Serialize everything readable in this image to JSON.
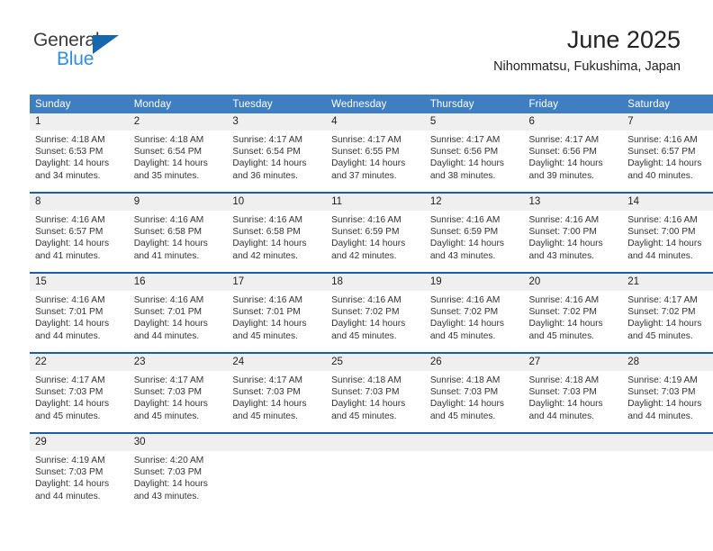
{
  "logo": {
    "word_top": "General",
    "word_bottom": "Blue",
    "triangle_color": "#1666b0",
    "top_color": "#3c3c3c",
    "bottom_color": "#2e8fe0"
  },
  "header": {
    "title": "June 2025",
    "subtitle": "Nihommatsu, Fukushima, Japan"
  },
  "theme": {
    "header_bg": "#3f7fc1",
    "header_text": "#ffffff",
    "daynum_bg": "#efefef",
    "rule_color": "#1a5fa4",
    "body_text": "#333333"
  },
  "weekdays": [
    "Sunday",
    "Monday",
    "Tuesday",
    "Wednesday",
    "Thursday",
    "Friday",
    "Saturday"
  ],
  "weeks": [
    {
      "days": [
        {
          "num": "1",
          "sunrise": "Sunrise: 4:18 AM",
          "sunset": "Sunset: 6:53 PM",
          "daylight1": "Daylight: 14 hours",
          "daylight2": "and 34 minutes."
        },
        {
          "num": "2",
          "sunrise": "Sunrise: 4:18 AM",
          "sunset": "Sunset: 6:54 PM",
          "daylight1": "Daylight: 14 hours",
          "daylight2": "and 35 minutes."
        },
        {
          "num": "3",
          "sunrise": "Sunrise: 4:17 AM",
          "sunset": "Sunset: 6:54 PM",
          "daylight1": "Daylight: 14 hours",
          "daylight2": "and 36 minutes."
        },
        {
          "num": "4",
          "sunrise": "Sunrise: 4:17 AM",
          "sunset": "Sunset: 6:55 PM",
          "daylight1": "Daylight: 14 hours",
          "daylight2": "and 37 minutes."
        },
        {
          "num": "5",
          "sunrise": "Sunrise: 4:17 AM",
          "sunset": "Sunset: 6:56 PM",
          "daylight1": "Daylight: 14 hours",
          "daylight2": "and 38 minutes."
        },
        {
          "num": "6",
          "sunrise": "Sunrise: 4:17 AM",
          "sunset": "Sunset: 6:56 PM",
          "daylight1": "Daylight: 14 hours",
          "daylight2": "and 39 minutes."
        },
        {
          "num": "7",
          "sunrise": "Sunrise: 4:16 AM",
          "sunset": "Sunset: 6:57 PM",
          "daylight1": "Daylight: 14 hours",
          "daylight2": "and 40 minutes."
        }
      ]
    },
    {
      "days": [
        {
          "num": "8",
          "sunrise": "Sunrise: 4:16 AM",
          "sunset": "Sunset: 6:57 PM",
          "daylight1": "Daylight: 14 hours",
          "daylight2": "and 41 minutes."
        },
        {
          "num": "9",
          "sunrise": "Sunrise: 4:16 AM",
          "sunset": "Sunset: 6:58 PM",
          "daylight1": "Daylight: 14 hours",
          "daylight2": "and 41 minutes."
        },
        {
          "num": "10",
          "sunrise": "Sunrise: 4:16 AM",
          "sunset": "Sunset: 6:58 PM",
          "daylight1": "Daylight: 14 hours",
          "daylight2": "and 42 minutes."
        },
        {
          "num": "11",
          "sunrise": "Sunrise: 4:16 AM",
          "sunset": "Sunset: 6:59 PM",
          "daylight1": "Daylight: 14 hours",
          "daylight2": "and 42 minutes."
        },
        {
          "num": "12",
          "sunrise": "Sunrise: 4:16 AM",
          "sunset": "Sunset: 6:59 PM",
          "daylight1": "Daylight: 14 hours",
          "daylight2": "and 43 minutes."
        },
        {
          "num": "13",
          "sunrise": "Sunrise: 4:16 AM",
          "sunset": "Sunset: 7:00 PM",
          "daylight1": "Daylight: 14 hours",
          "daylight2": "and 43 minutes."
        },
        {
          "num": "14",
          "sunrise": "Sunrise: 4:16 AM",
          "sunset": "Sunset: 7:00 PM",
          "daylight1": "Daylight: 14 hours",
          "daylight2": "and 44 minutes."
        }
      ]
    },
    {
      "days": [
        {
          "num": "15",
          "sunrise": "Sunrise: 4:16 AM",
          "sunset": "Sunset: 7:01 PM",
          "daylight1": "Daylight: 14 hours",
          "daylight2": "and 44 minutes."
        },
        {
          "num": "16",
          "sunrise": "Sunrise: 4:16 AM",
          "sunset": "Sunset: 7:01 PM",
          "daylight1": "Daylight: 14 hours",
          "daylight2": "and 44 minutes."
        },
        {
          "num": "17",
          "sunrise": "Sunrise: 4:16 AM",
          "sunset": "Sunset: 7:01 PM",
          "daylight1": "Daylight: 14 hours",
          "daylight2": "and 45 minutes."
        },
        {
          "num": "18",
          "sunrise": "Sunrise: 4:16 AM",
          "sunset": "Sunset: 7:02 PM",
          "daylight1": "Daylight: 14 hours",
          "daylight2": "and 45 minutes."
        },
        {
          "num": "19",
          "sunrise": "Sunrise: 4:16 AM",
          "sunset": "Sunset: 7:02 PM",
          "daylight1": "Daylight: 14 hours",
          "daylight2": "and 45 minutes."
        },
        {
          "num": "20",
          "sunrise": "Sunrise: 4:16 AM",
          "sunset": "Sunset: 7:02 PM",
          "daylight1": "Daylight: 14 hours",
          "daylight2": "and 45 minutes."
        },
        {
          "num": "21",
          "sunrise": "Sunrise: 4:17 AM",
          "sunset": "Sunset: 7:02 PM",
          "daylight1": "Daylight: 14 hours",
          "daylight2": "and 45 minutes."
        }
      ]
    },
    {
      "days": [
        {
          "num": "22",
          "sunrise": "Sunrise: 4:17 AM",
          "sunset": "Sunset: 7:03 PM",
          "daylight1": "Daylight: 14 hours",
          "daylight2": "and 45 minutes."
        },
        {
          "num": "23",
          "sunrise": "Sunrise: 4:17 AM",
          "sunset": "Sunset: 7:03 PM",
          "daylight1": "Daylight: 14 hours",
          "daylight2": "and 45 minutes."
        },
        {
          "num": "24",
          "sunrise": "Sunrise: 4:17 AM",
          "sunset": "Sunset: 7:03 PM",
          "daylight1": "Daylight: 14 hours",
          "daylight2": "and 45 minutes."
        },
        {
          "num": "25",
          "sunrise": "Sunrise: 4:18 AM",
          "sunset": "Sunset: 7:03 PM",
          "daylight1": "Daylight: 14 hours",
          "daylight2": "and 45 minutes."
        },
        {
          "num": "26",
          "sunrise": "Sunrise: 4:18 AM",
          "sunset": "Sunset: 7:03 PM",
          "daylight1": "Daylight: 14 hours",
          "daylight2": "and 45 minutes."
        },
        {
          "num": "27",
          "sunrise": "Sunrise: 4:18 AM",
          "sunset": "Sunset: 7:03 PM",
          "daylight1": "Daylight: 14 hours",
          "daylight2": "and 44 minutes."
        },
        {
          "num": "28",
          "sunrise": "Sunrise: 4:19 AM",
          "sunset": "Sunset: 7:03 PM",
          "daylight1": "Daylight: 14 hours",
          "daylight2": "and 44 minutes."
        }
      ]
    },
    {
      "days": [
        {
          "num": "29",
          "sunrise": "Sunrise: 4:19 AM",
          "sunset": "Sunset: 7:03 PM",
          "daylight1": "Daylight: 14 hours",
          "daylight2": "and 44 minutes."
        },
        {
          "num": "30",
          "sunrise": "Sunrise: 4:20 AM",
          "sunset": "Sunset: 7:03 PM",
          "daylight1": "Daylight: 14 hours",
          "daylight2": "and 43 minutes."
        },
        {
          "num": "",
          "sunrise": "",
          "sunset": "",
          "daylight1": "",
          "daylight2": ""
        },
        {
          "num": "",
          "sunrise": "",
          "sunset": "",
          "daylight1": "",
          "daylight2": ""
        },
        {
          "num": "",
          "sunrise": "",
          "sunset": "",
          "daylight1": "",
          "daylight2": ""
        },
        {
          "num": "",
          "sunrise": "",
          "sunset": "",
          "daylight1": "",
          "daylight2": ""
        },
        {
          "num": "",
          "sunrise": "",
          "sunset": "",
          "daylight1": "",
          "daylight2": ""
        }
      ]
    }
  ]
}
